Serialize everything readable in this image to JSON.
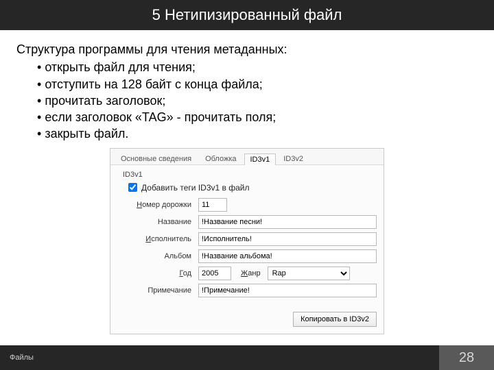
{
  "title": "5 Нетипизированный файл",
  "intro": "Структура программы для чтения метаданных:",
  "bullets": [
    "открыть файл для чтения;",
    "отступить на 128 байт с конца файла;",
    "прочитать заголовок;",
    "если заголовок «TAG» - прочитать поля;",
    "закрыть файл."
  ],
  "dialog": {
    "tabs": [
      "Основные сведения",
      "Обложка",
      "ID3v1",
      "ID3v2"
    ],
    "active_tab": "ID3v1",
    "group_title": "ID3v1",
    "checkbox_label": "Добавить теги ID3v1 в файл",
    "fields": {
      "track_label_pre": "Н",
      "track_label_post": "омер дорожки",
      "track_value": "11",
      "title_label": "Название",
      "title_value": "!Название песни!",
      "artist_label_pre": "И",
      "artist_label_post": "сполнитель",
      "artist_value": "!Исполнитель!",
      "album_label": "Альбом",
      "album_value": "!Название альбома!",
      "year_label_pre": "Г",
      "year_label_post": "од",
      "year_value": "2005",
      "genre_label_pre": "Ж",
      "genre_label_post": "анр",
      "genre_value": "Rap",
      "note_label": "Примечание",
      "note_value": "!Примечание!"
    },
    "copy_button": "Копировать в ID3v2"
  },
  "footer": {
    "left": "Файлы",
    "page": "28"
  }
}
